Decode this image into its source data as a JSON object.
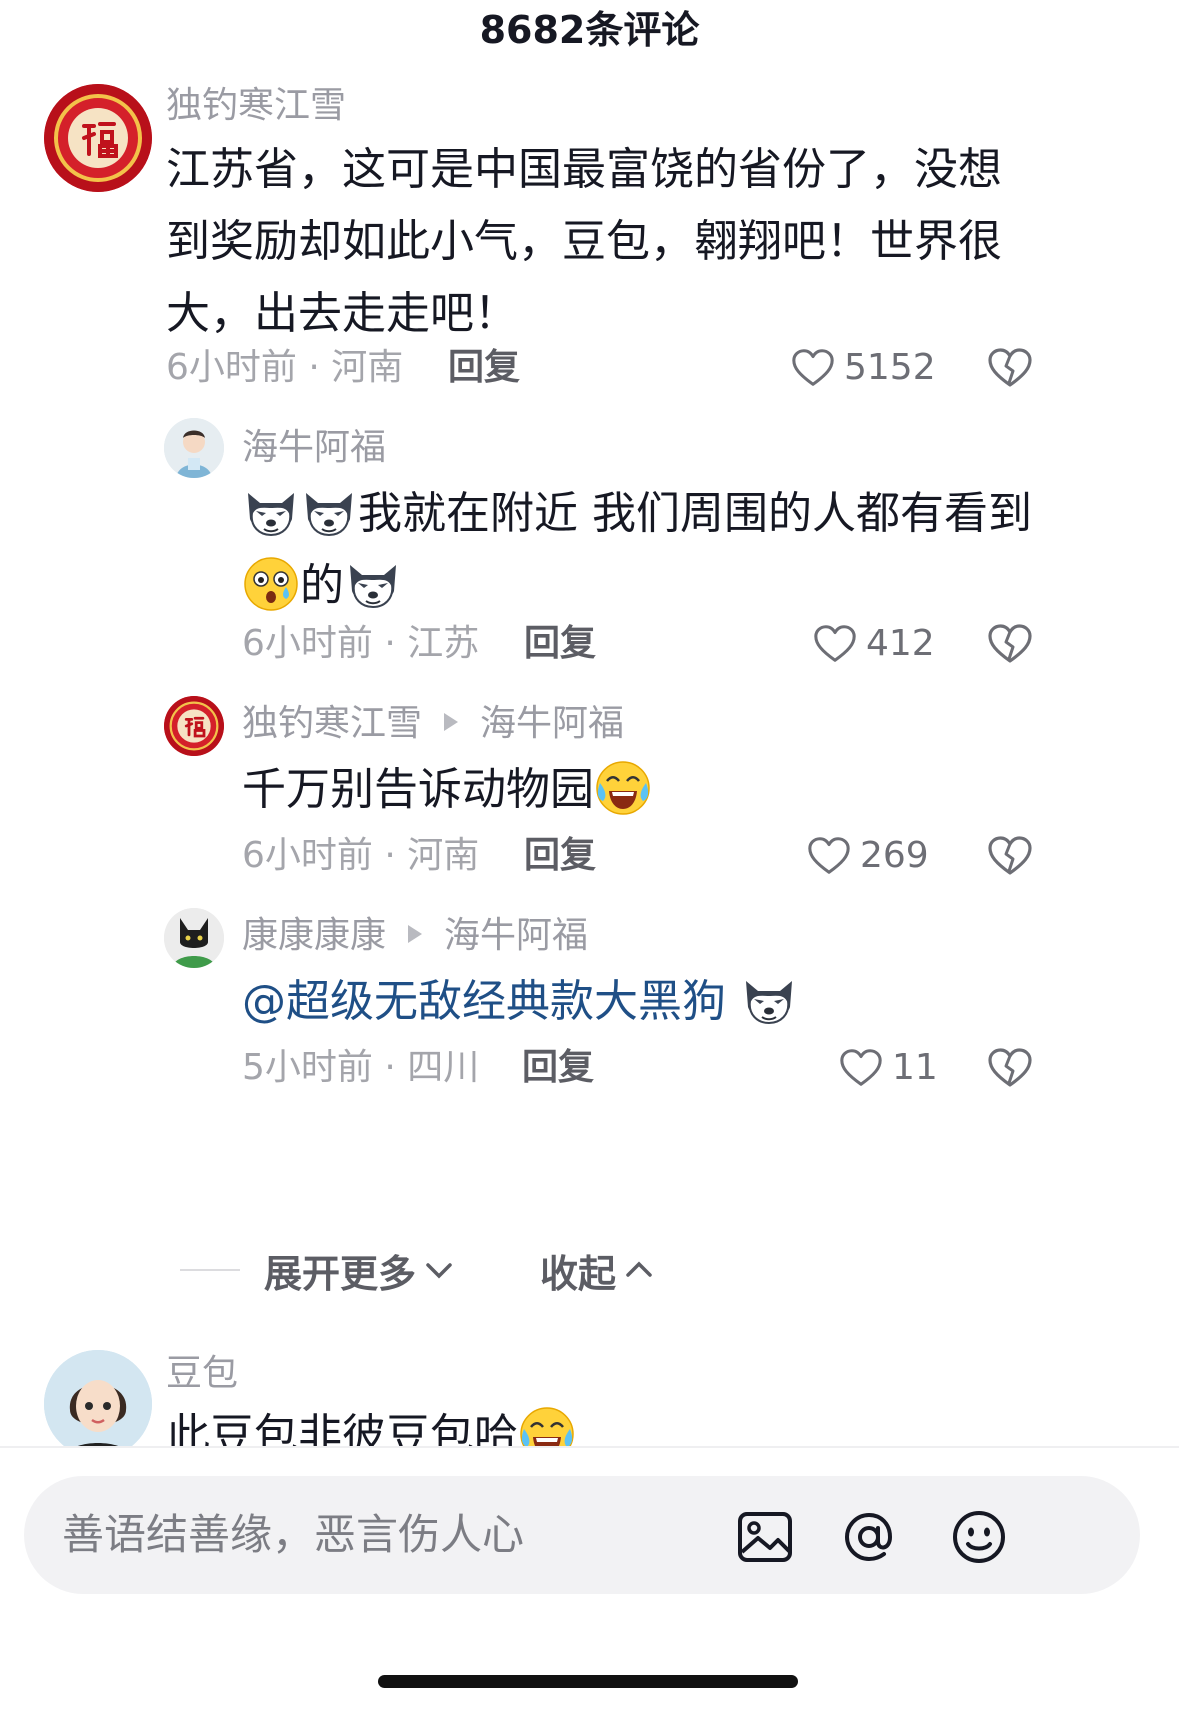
{
  "header": {
    "title": "8682条评论"
  },
  "comments": [
    {
      "name": "独钓寒江雪",
      "text": "江苏省，这可是中国最富饶的省份了，没想到奖励却如此小气，豆包，翱翔吧！世界很大，出去走走吧！",
      "meta": "6小时前 · 河南",
      "reply": "回复",
      "likes": "5152"
    }
  ],
  "replies": [
    {
      "name": "海牛阿福",
      "text_a": "我就在附近  我们周围的人都有看到",
      "text_b": "的",
      "meta": "6小时前 · 江苏",
      "reply": "回复",
      "likes": "412"
    },
    {
      "name": "独钓寒江雪",
      "reply_to": "海牛阿福",
      "text": "千万别告诉动物园",
      "meta": "6小时前 · 河南",
      "reply": "回复",
      "likes": "269"
    },
    {
      "name": "康康康康",
      "reply_to": "海牛阿福",
      "text": "@超级无敌经典款大黑狗",
      "meta": "5小时前 · 四川",
      "reply": "回复",
      "likes": "11"
    }
  ],
  "expand": {
    "more": "展开更多",
    "collapse": "收起"
  },
  "partial_comment": {
    "name": "豆包",
    "text": "此豆包非彼豆包哈"
  },
  "input": {
    "placeholder": "善语结善缘，恶言伤人心"
  },
  "icons": [
    "heart-icon",
    "broken-heart-icon",
    "image-icon",
    "at-icon",
    "emoji-icon",
    "chevron-down-icon",
    "chevron-up-icon"
  ],
  "colors": {
    "text": "#161823",
    "meta": "#a4a5ab",
    "mention": "#1f4f86",
    "input_bg": "#f2f2f4"
  }
}
